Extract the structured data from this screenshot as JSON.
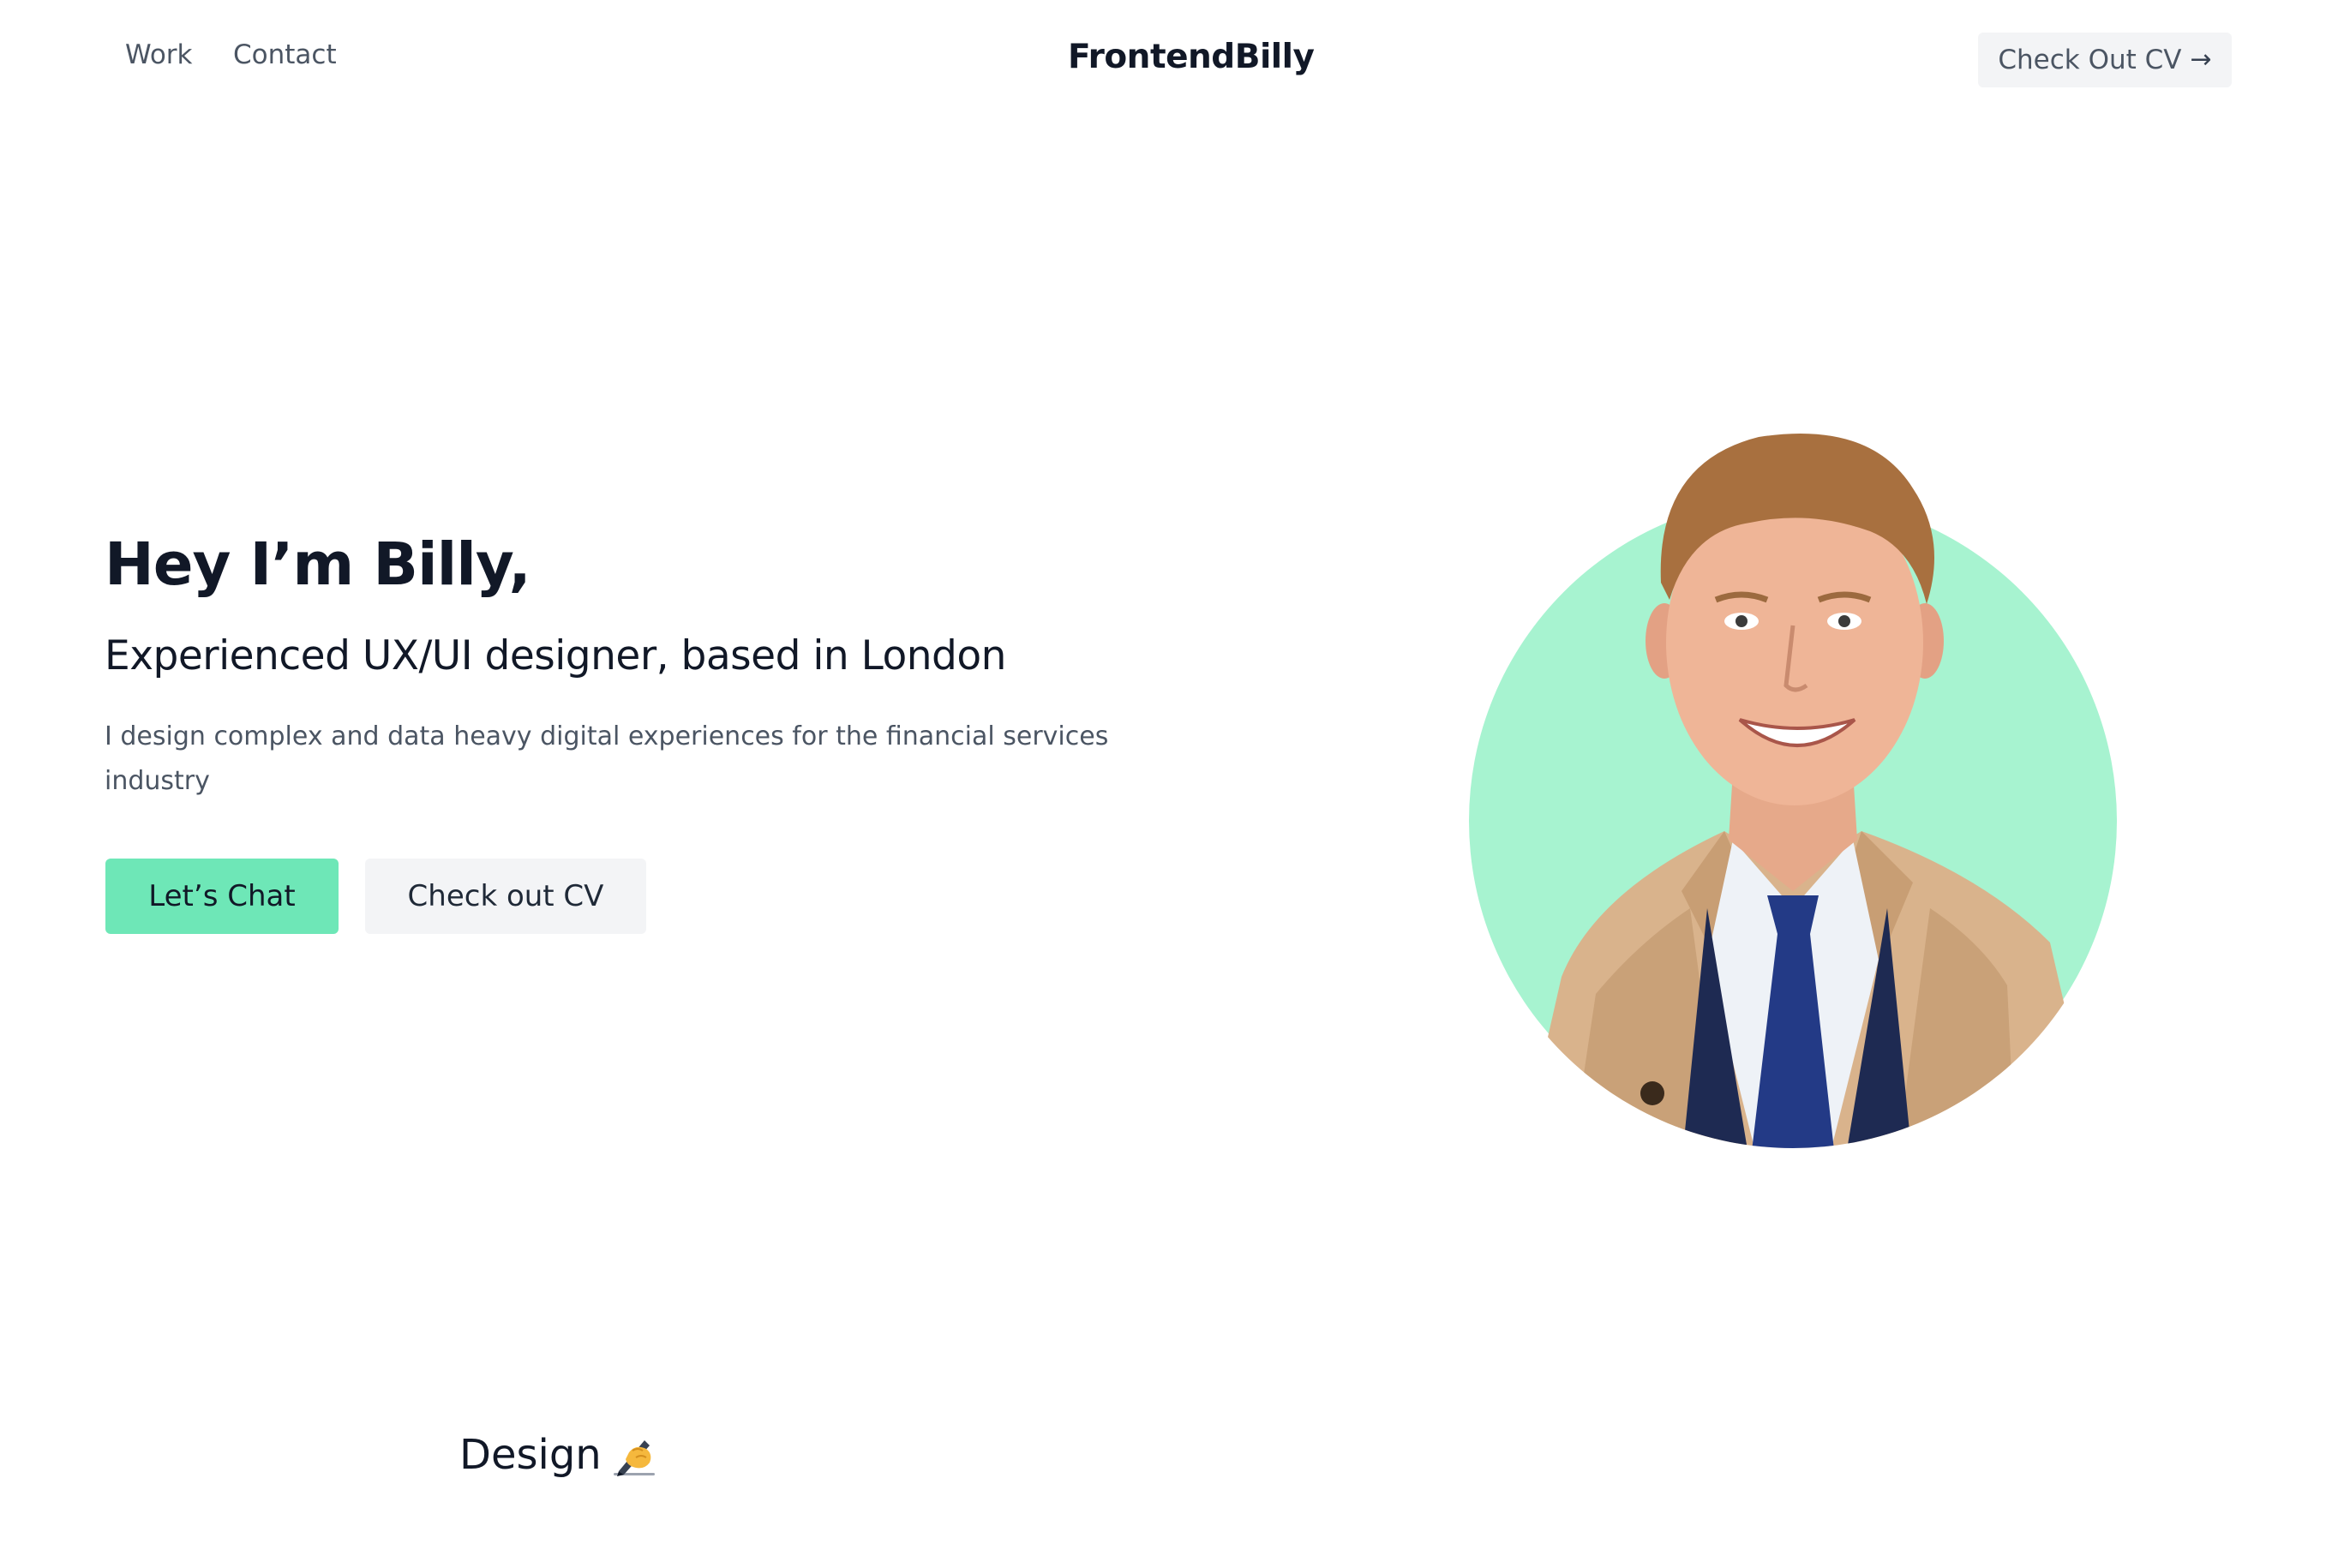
{
  "nav": {
    "links": [
      {
        "label": "Work"
      },
      {
        "label": "Contact"
      }
    ],
    "brand": "FrontendBilly",
    "cv_button": {
      "label": "Check Out CV",
      "icon": "arrow-right-icon"
    }
  },
  "hero": {
    "title": "Hey I’m Billy,",
    "subtitle": "Experienced UX/UI designer, based in London",
    "description": "I design complex and data heavy digital experiences for the financial services industry",
    "primary_button": "Let’s Chat",
    "secondary_button": "Check out CV",
    "portrait": {
      "icon": "portrait-photo",
      "accent_color": "#a7f3d0"
    }
  },
  "section": {
    "title": "Design",
    "emoji_icon": "writing-hand-icon"
  },
  "colors": {
    "accent": "#6ee7b7",
    "portrait_bg": "#a7f3d0",
    "neutral_button": "#f3f4f6",
    "text_primary": "#111827",
    "text_secondary": "#4b5563"
  }
}
